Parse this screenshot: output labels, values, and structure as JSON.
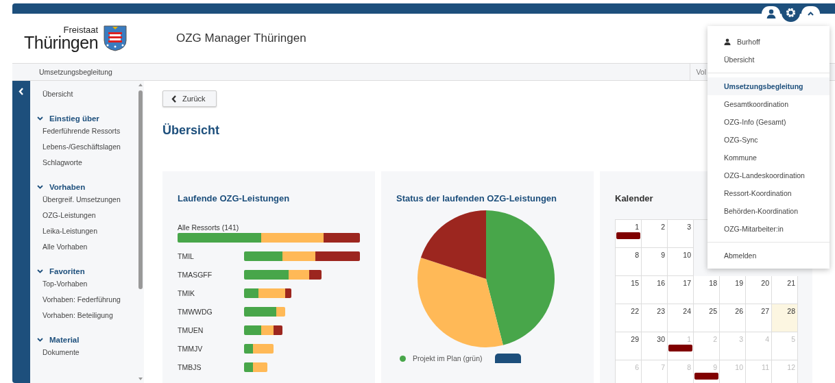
{
  "header": {
    "logo_small": "Freistaat",
    "logo_big": "Thüringen",
    "title": "OZG Manager Thüringen"
  },
  "subnav": [
    {
      "label": "Umsetzungsbegleitung",
      "kind": "main"
    },
    {
      "label": "Vol",
      "kind": "right"
    }
  ],
  "sidebar": {
    "items": [
      {
        "label": "Übersicht"
      },
      {
        "label": "Einstieg über",
        "expanded": true,
        "children": [
          {
            "label": "Federführende Ressorts"
          },
          {
            "label": "Lebens-/Geschäftslagen"
          },
          {
            "label": "Schlagworte"
          }
        ]
      },
      {
        "label": "Vorhaben",
        "expanded": true,
        "children": [
          {
            "label": "Übergreif. Umsetzungen"
          },
          {
            "label": "OZG-Leistungen"
          },
          {
            "label": "Leika-Leistungen"
          },
          {
            "label": "Alle Vorhaben"
          }
        ]
      },
      {
        "label": "Favoriten",
        "expanded": true,
        "children": [
          {
            "label": "Top-Vorhaben"
          },
          {
            "label": "Vorhaben: Federführung"
          },
          {
            "label": "Vorhaben: Beteiligung"
          }
        ]
      },
      {
        "label": "Material",
        "expanded": true,
        "children": [
          {
            "label": "Dokumente"
          }
        ]
      }
    ]
  },
  "back_button": "Zurück",
  "page_title": "Übersicht",
  "bar_card": {
    "title": "Laufende OZG-Leistungen",
    "rows": [
      {
        "label": "Alle Ressorts (141)",
        "kind": "total"
      },
      {
        "label": "TMIL",
        "kind": "ressort"
      },
      {
        "label": "TMASGFF",
        "kind": "ressort"
      },
      {
        "label": "TMIK",
        "kind": "ressort"
      },
      {
        "label": "TMWWDG",
        "kind": "ressort"
      },
      {
        "label": "TMUEN",
        "kind": "ressort"
      },
      {
        "label": "TMMJV",
        "kind": "ressort"
      },
      {
        "label": "TMBJS",
        "kind": "ressort"
      }
    ]
  },
  "pie_card": {
    "chart_data": {
      "type": "pie",
      "title": "Status der laufenden OZG-Leistungen",
      "values": [
        46,
        34,
        20
      ],
      "colors": [
        "#48a64a",
        "#ffb957",
        "#9c261f"
      ]
    },
    "legend": [
      {
        "label": "Projekt im Plan (grün)",
        "color": "#48a64a"
      }
    ]
  },
  "calendar": {
    "title": "Kalender",
    "weeks": [
      [
        {
          "day": "1",
          "other_month": false,
          "today": false,
          "event": true
        },
        {
          "day": "2",
          "other_month": false,
          "today": false,
          "event": false
        },
        {
          "day": "3",
          "other_month": false,
          "today": false,
          "event": false
        }
      ],
      [
        {
          "day": "8",
          "other_month": false,
          "today": false,
          "event": false
        },
        {
          "day": "9",
          "other_month": false,
          "today": false,
          "event": false
        },
        {
          "day": "10",
          "other_month": false,
          "today": false,
          "event": false
        }
      ],
      [
        {
          "day": "15",
          "other_month": false,
          "today": false,
          "event": false
        },
        {
          "day": "16",
          "other_month": false,
          "today": false,
          "event": false
        },
        {
          "day": "17",
          "other_month": false,
          "today": false,
          "event": false
        },
        {
          "day": "18",
          "other_month": false,
          "today": false,
          "event": false
        },
        {
          "day": "19",
          "other_month": false,
          "today": false,
          "event": false
        },
        {
          "day": "20",
          "other_month": false,
          "today": false,
          "event": false
        },
        {
          "day": "21",
          "other_month": false,
          "today": false,
          "event": false
        }
      ],
      [
        {
          "day": "22",
          "other_month": false,
          "today": false,
          "event": false
        },
        {
          "day": "23",
          "other_month": false,
          "today": false,
          "event": false
        },
        {
          "day": "24",
          "other_month": false,
          "today": false,
          "event": false
        },
        {
          "day": "25",
          "other_month": false,
          "today": false,
          "event": false
        },
        {
          "day": "26",
          "other_month": false,
          "today": false,
          "event": false
        },
        {
          "day": "27",
          "other_month": false,
          "today": false,
          "event": false
        },
        {
          "day": "28",
          "other_month": false,
          "today": true,
          "event": false
        }
      ],
      [
        {
          "day": "29",
          "other_month": false,
          "today": false,
          "event": false
        },
        {
          "day": "30",
          "other_month": false,
          "today": false,
          "event": false
        },
        {
          "day": "1",
          "other_month": true,
          "today": false,
          "event": true
        },
        {
          "day": "2",
          "other_month": true,
          "today": false,
          "event": false
        },
        {
          "day": "3",
          "other_month": true,
          "today": false,
          "event": false
        },
        {
          "day": "4",
          "other_month": true,
          "today": false,
          "event": false
        },
        {
          "day": "5",
          "other_month": true,
          "today": false,
          "event": false
        }
      ],
      [
        {
          "day": "6",
          "other_month": true,
          "today": false,
          "event": false
        },
        {
          "day": "7",
          "other_month": true,
          "today": false,
          "event": false
        },
        {
          "day": "8",
          "other_month": true,
          "today": false,
          "event": false
        },
        {
          "day": "9",
          "other_month": true,
          "today": false,
          "event": true
        },
        {
          "day": "10",
          "other_month": true,
          "today": false,
          "event": false
        },
        {
          "day": "11",
          "other_month": true,
          "today": false,
          "event": false
        },
        {
          "day": "12",
          "other_month": true,
          "today": false,
          "event": false
        }
      ]
    ]
  },
  "user_menu": {
    "sections": [
      [
        {
          "label": "Burhoff",
          "kind": "user",
          "selected": false
        },
        {
          "label": "Übersicht",
          "kind": "link",
          "selected": false
        }
      ],
      [
        {
          "label": "Umsetzungsbegleitung",
          "kind": "link",
          "selected": true
        },
        {
          "label": "Gesamtkoordination",
          "kind": "link",
          "selected": false
        },
        {
          "label": "OZG-Info (Gesamt)",
          "kind": "link",
          "selected": false
        },
        {
          "label": "OZG-Sync",
          "kind": "link",
          "selected": false
        },
        {
          "label": "Kommune",
          "kind": "link",
          "selected": false
        },
        {
          "label": "OZG-Landeskoordination",
          "kind": "link",
          "selected": false
        },
        {
          "label": "Ressort-Koordination",
          "kind": "link",
          "selected": false
        },
        {
          "label": "Behörden-Koordination",
          "kind": "link",
          "selected": false
        },
        {
          "label": "OZG-Mitarbeiter:in",
          "kind": "link",
          "selected": false
        }
      ],
      [
        {
          "label": "Abmelden",
          "kind": "link",
          "selected": false
        }
      ]
    ]
  }
}
